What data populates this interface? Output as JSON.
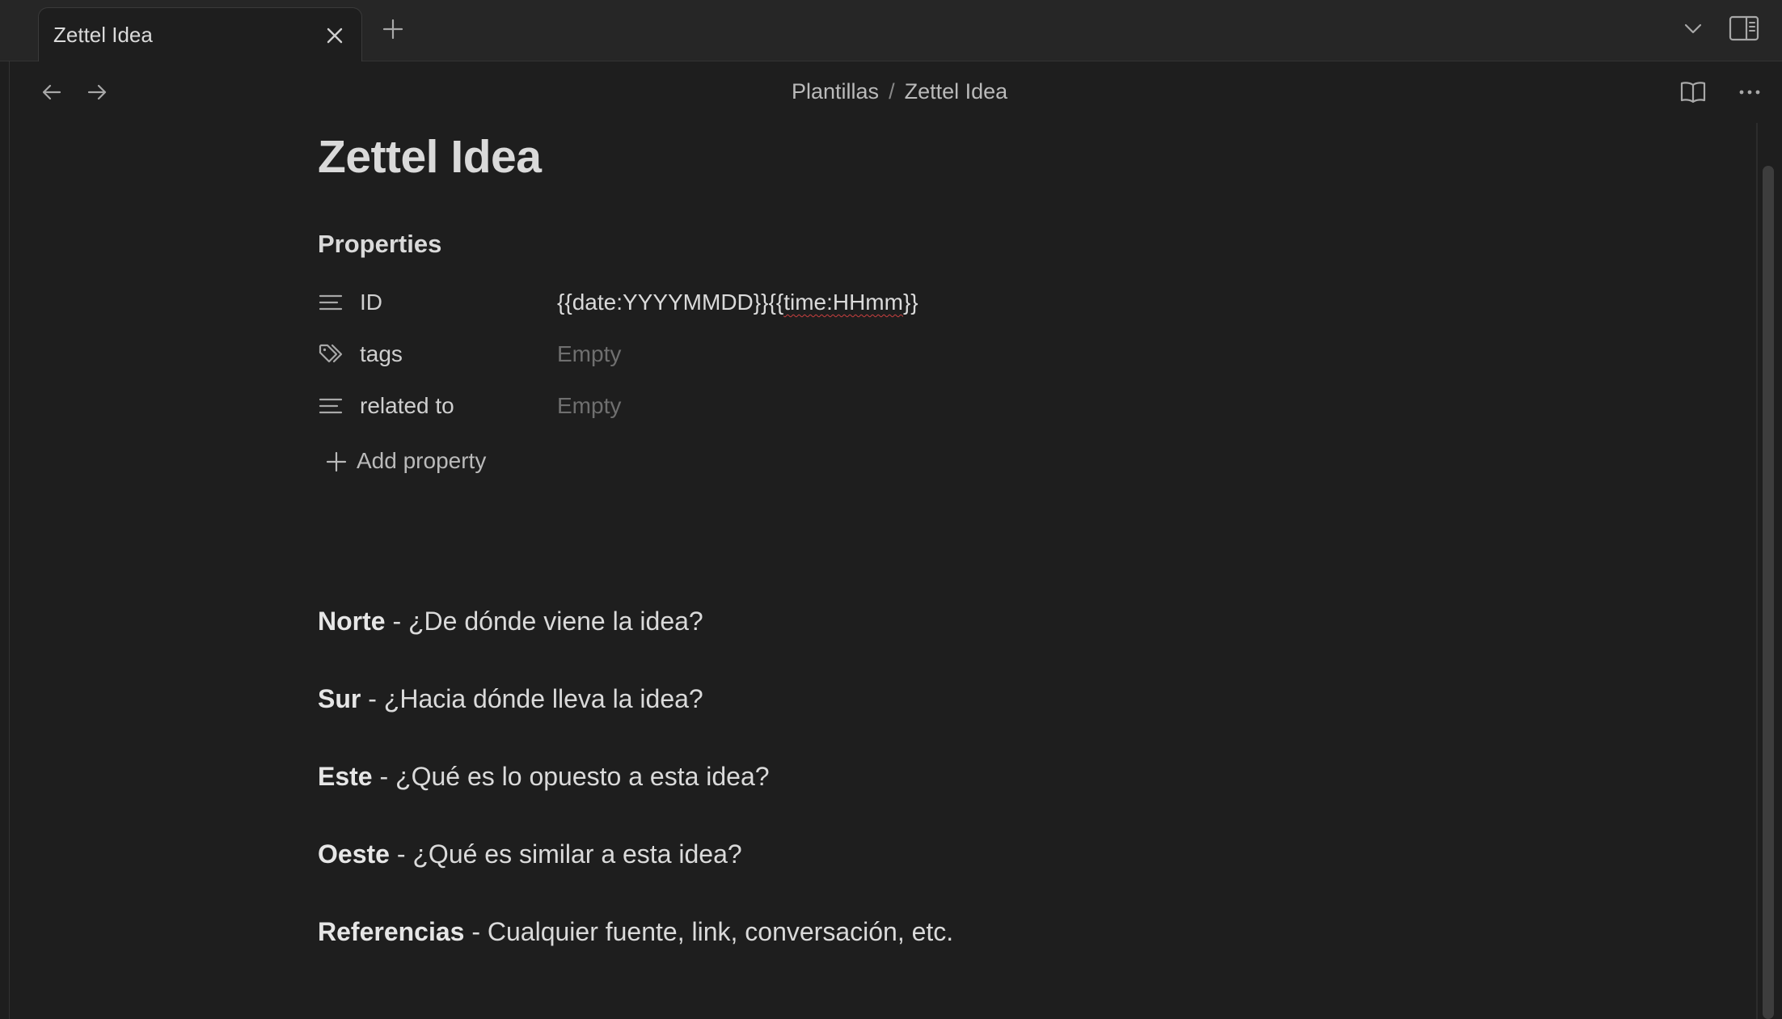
{
  "tabs": [
    {
      "label": "Zettel Idea",
      "active": true
    }
  ],
  "breadcrumb": {
    "folder": "Plantillas",
    "separator": "/",
    "file": "Zettel Idea"
  },
  "note": {
    "title": "Zettel Idea",
    "properties_heading": "Properties",
    "properties": [
      {
        "icon": "text-lines-icon",
        "key": "ID",
        "value_prefix": "{{date:YYYYMMDD}}{{",
        "value_misspelled": "time:HHmm",
        "value_suffix": "}}"
      },
      {
        "icon": "tags-icon",
        "key": "tags",
        "value": "Empty"
      },
      {
        "icon": "text-lines-icon",
        "key": "related to",
        "value": "Empty"
      }
    ],
    "add_property_label": "Add property",
    "body": [
      {
        "bold": "Norte",
        "text": " - ¿De dónde viene la idea?"
      },
      {
        "bold": "Sur",
        "text": " - ¿Hacia dónde lleva la idea?"
      },
      {
        "bold": "Este",
        "text": " - ¿Qué es lo opuesto a esta idea?"
      },
      {
        "bold": "Oeste",
        "text": " - ¿Qué es similar a esta idea?"
      },
      {
        "bold": "Referencias",
        "text": " - Cualquier fuente, link, conversación, etc."
      }
    ]
  },
  "colors": {
    "background": "#1e1e1e",
    "tabbar": "#262626",
    "text": "#dadada",
    "muted": "#6f6f6f",
    "spellcheck": "#c94040"
  }
}
